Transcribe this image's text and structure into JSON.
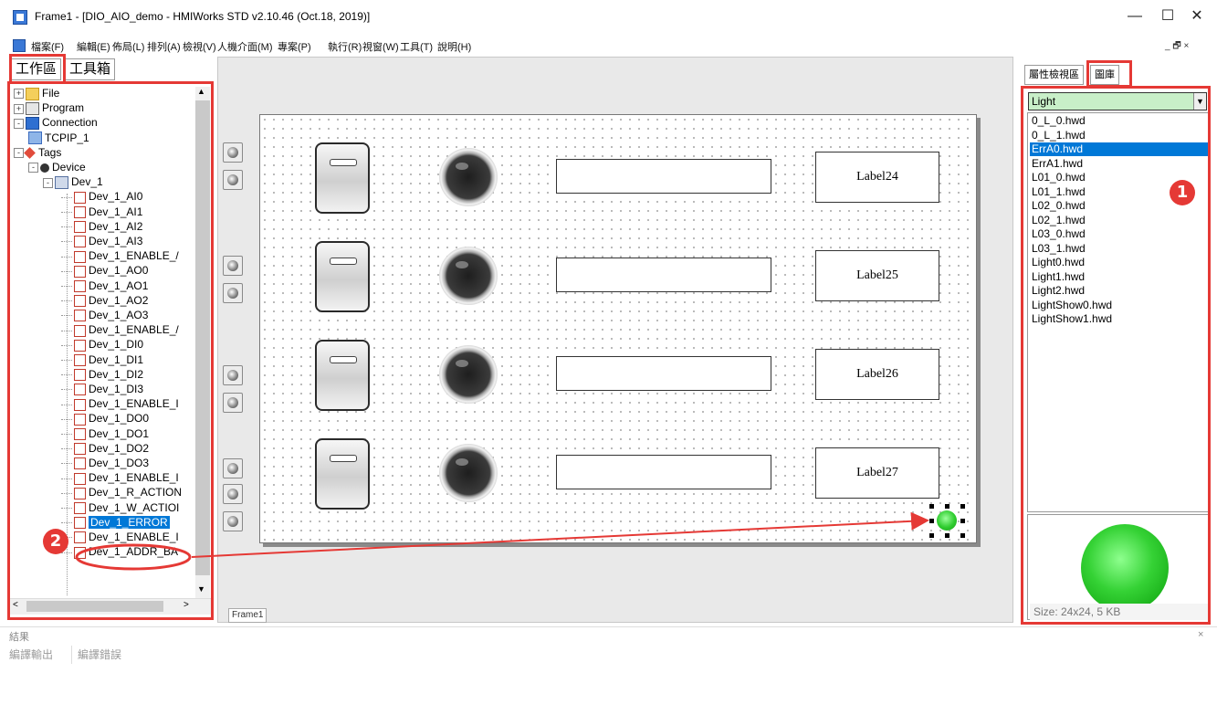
{
  "window": {
    "title": "Frame1 - [DIO_AIO_demo - HMIWorks STD v2.10.46 (Oct.18, 2019)]",
    "minimize": "—",
    "maximize": "☐",
    "close": "✕"
  },
  "menu": [
    "檔案(F)",
    "編輯(E)",
    "佈局(L)",
    "排列(A)",
    "檢視(V)",
    "人機介面(M)",
    "專案(P)",
    "執行(R)",
    "視窗(W)",
    "工具(T)",
    "說明(H)"
  ],
  "mdi_controls": "_ 🗗 ×",
  "left_tabs": [
    "工作區",
    "工具箱"
  ],
  "tree": [
    {
      "label": "File",
      "icon": "folder-icon",
      "exp": "+"
    },
    {
      "label": "Program",
      "icon": "program-icon",
      "exp": "+"
    },
    {
      "label": "Connection",
      "icon": "connection-icon",
      "exp": "-"
    },
    {
      "label": "TCPIP_1",
      "icon": "tcpip-icon",
      "exp": ""
    },
    {
      "label": "Tags",
      "icon": "tags-icon",
      "exp": "-"
    },
    {
      "label": "Device",
      "icon": "device-icon",
      "exp": "-"
    },
    {
      "label": "Dev_1",
      "icon": "dev-icon",
      "exp": "-"
    },
    {
      "label": "Dev_1_AI0",
      "icon": "tag-icon"
    },
    {
      "label": "Dev_1_AI1",
      "icon": "tag-icon"
    },
    {
      "label": "Dev_1_AI2",
      "icon": "tag-icon"
    },
    {
      "label": "Dev_1_AI3",
      "icon": "tag-icon"
    },
    {
      "label": "Dev_1_ENABLE_/",
      "icon": "tag-icon"
    },
    {
      "label": "Dev_1_AO0",
      "icon": "tag-icon"
    },
    {
      "label": "Dev_1_AO1",
      "icon": "tag-icon"
    },
    {
      "label": "Dev_1_AO2",
      "icon": "tag-icon"
    },
    {
      "label": "Dev_1_AO3",
      "icon": "tag-icon"
    },
    {
      "label": "Dev_1_ENABLE_/",
      "icon": "tag-icon"
    },
    {
      "label": "Dev_1_DI0",
      "icon": "tag-icon"
    },
    {
      "label": "Dev_1_DI1",
      "icon": "tag-icon"
    },
    {
      "label": "Dev_1_DI2",
      "icon": "tag-icon"
    },
    {
      "label": "Dev_1_DI3",
      "icon": "tag-icon"
    },
    {
      "label": "Dev_1_ENABLE_I",
      "icon": "tag-icon"
    },
    {
      "label": "Dev_1_DO0",
      "icon": "tag-icon"
    },
    {
      "label": "Dev_1_DO1",
      "icon": "tag-icon"
    },
    {
      "label": "Dev_1_DO2",
      "icon": "tag-icon"
    },
    {
      "label": "Dev_1_DO3",
      "icon": "tag-icon"
    },
    {
      "label": "Dev_1_ENABLE_I",
      "icon": "tag-icon"
    },
    {
      "label": "Dev_1_R_ACTION",
      "icon": "tag-icon"
    },
    {
      "label": "Dev_1_W_ACTIOI",
      "icon": "tag-icon"
    },
    {
      "label": "Dev_1_ERROR",
      "icon": "tag-icon",
      "selected": true
    },
    {
      "label": "Dev_1_ENABLE_I",
      "icon": "tag-icon"
    },
    {
      "label": "Dev_1_ADDR_BA",
      "icon": "tag-icon"
    }
  ],
  "canvas": {
    "tab": "Frame1",
    "labels": [
      "Label24",
      "Label25",
      "Label26",
      "Label27"
    ]
  },
  "right_tabs": [
    "屬性檢視區",
    "圖庫"
  ],
  "library": {
    "category": "Light",
    "files": [
      "0_L_0.hwd",
      "0_L_1.hwd",
      "ErrA0.hwd",
      "ErrA1.hwd",
      "L01_0.hwd",
      "L01_1.hwd",
      "L02_0.hwd",
      "L02_1.hwd",
      "L03_0.hwd",
      "L03_1.hwd",
      "Light0.hwd",
      "Light1.hwd",
      "Light2.hwd",
      "LightShow0.hwd",
      "LightShow1.hwd"
    ],
    "selected": "ErrA0.hwd",
    "size_info": "Size: 24x24, 5 KB"
  },
  "results": {
    "title": "結果",
    "close": "×",
    "tabs": [
      "編譯輸出",
      "編譯錯誤"
    ]
  },
  "annotations": {
    "badge1": "1",
    "badge2": "2"
  },
  "colors": {
    "highlight": "#e53935",
    "selection": "#0078d7",
    "lamp_green": "#2ecc2e"
  }
}
